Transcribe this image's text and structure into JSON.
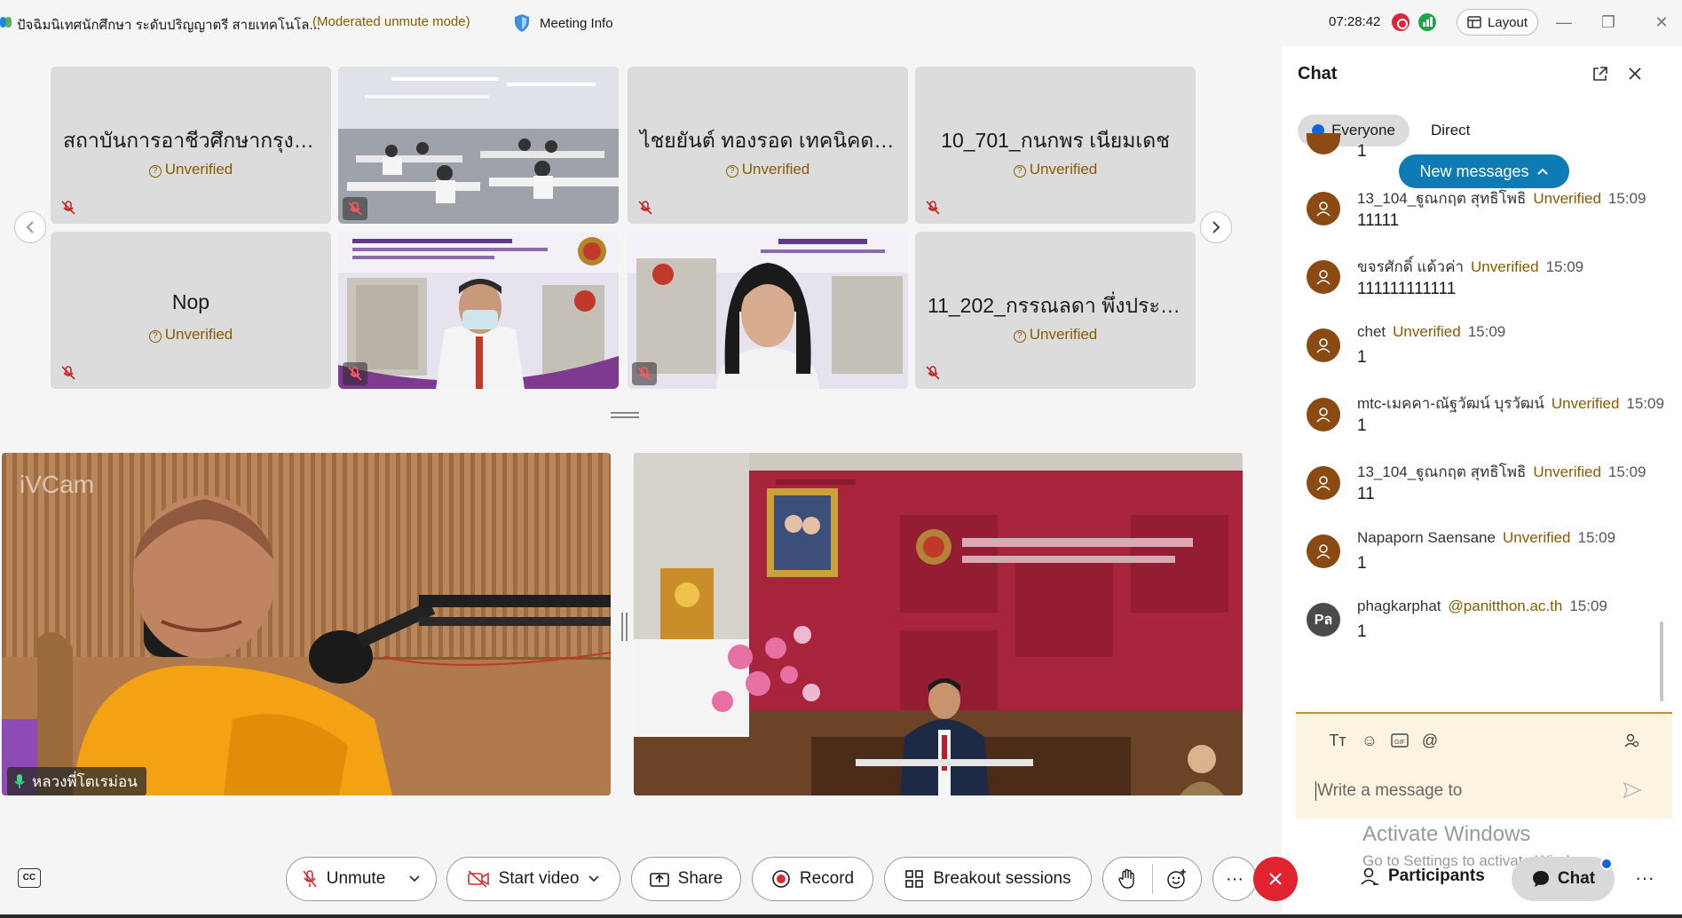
{
  "title": {
    "meeting_name": "ปัจฉิมนิเทศนักศึกษา ระดับปริญญาตรี สายเทคโนโล...",
    "mode": "(Moderated unmute mode)",
    "meeting_info": "Meeting Info",
    "clock": "07:28:42",
    "layout_label": "Layout"
  },
  "thumbnails": [
    {
      "name": "สถาบันการอาชีวศึกษากรุงเท...",
      "status": "Unverified"
    },
    {
      "name": "",
      "status": ""
    },
    {
      "name": "ไชยยันต์ ทองรอด เทคนิคดอ...",
      "status": "Unverified"
    },
    {
      "name": "10_701_กนกพร เนียมเดช",
      "status": "Unverified"
    },
    {
      "name": "Nop",
      "status": "Unverified"
    },
    {
      "name": "",
      "status": ""
    },
    {
      "name": "",
      "status": ""
    },
    {
      "name": "11_202_กรรณลดา พึ่งประชา",
      "status": "Unverified"
    }
  ],
  "main_video": {
    "left_name": "หลวงพี่โตเรม่อน",
    "watermark": "iVCam"
  },
  "chat": {
    "title": "Chat",
    "tab_everyone": "Everyone",
    "tab_direct": "Direct",
    "new_messages": "New messages",
    "partial_body": "1",
    "messages": [
      {
        "sender": "13_104_ฐูณกฤต สุทธิโพธิ",
        "tag": "Unverified",
        "time": "15:09",
        "body": "11111"
      },
      {
        "sender": "ขจรศักดิ์ แด้วค่า",
        "tag": "Unverified",
        "time": "15:09",
        "body": "111111111111"
      },
      {
        "sender": "chet",
        "tag": "Unverified",
        "time": "15:09",
        "body": "1"
      },
      {
        "sender": "mtc-เมคคา-ณัฐวัฒน์ บุรวัฒน์",
        "tag": "Unverified",
        "time": "15:09",
        "body": "1"
      },
      {
        "sender": "13_104_ฐูณกฤต สุทธิโพธิ",
        "tag": "Unverified",
        "time": "15:09",
        "body": "11"
      },
      {
        "sender": "Napaporn Saensane",
        "tag": "Unverified",
        "time": "15:09",
        "body": "1"
      },
      {
        "sender": "phagkarphat",
        "tag": "@panitthon.ac.th",
        "time": "15:09",
        "body": "1",
        "initials": "Pล"
      }
    ],
    "composer_placeholder": "Write a message to",
    "activate_title": "Activate Windows",
    "activate_sub": "Go to Settings to activate Windows."
  },
  "toolbar": {
    "unmute": "Unmute",
    "start_video": "Start video",
    "share": "Share",
    "record": "Record",
    "breakout": "Breakout sessions",
    "participants": "Participants",
    "chat": "Chat",
    "cc": "CC"
  },
  "colors": {
    "accent_blue": "#0e7bb5",
    "unverified": "#8a5a00",
    "leave_red": "#e0232f"
  }
}
